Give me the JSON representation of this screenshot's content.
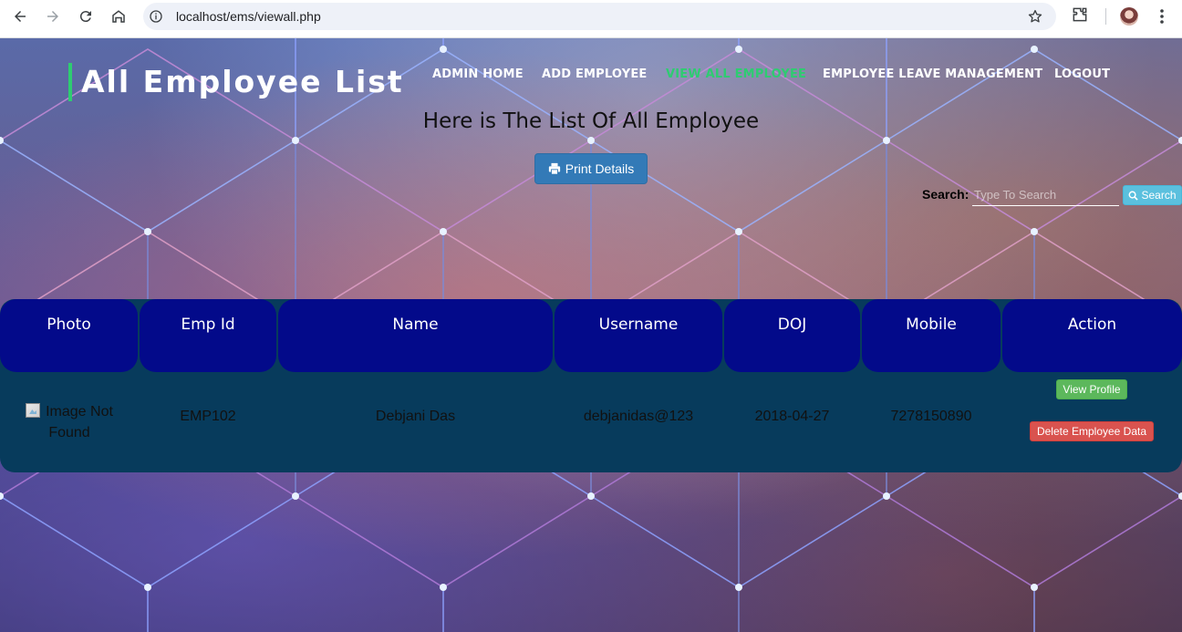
{
  "browser": {
    "url": "localhost/ems/viewall.php"
  },
  "header": {
    "brand": "All Employee List",
    "nav": [
      {
        "label": "ADMIN HOME",
        "active": false
      },
      {
        "label": "ADD EMPLOYEE",
        "active": false
      },
      {
        "label": "VIEW ALL EMPLOYEE",
        "active": true
      },
      {
        "label": "EMPLOYEE LEAVE MANAGEMENT",
        "active": false
      },
      {
        "label": "LOGOUT",
        "active": false
      }
    ]
  },
  "main": {
    "heading": "Here is The List Of All Employee",
    "print_label": "Print Details",
    "search": {
      "label": "Search:",
      "placeholder": "Type To Search",
      "button_label": "Search"
    }
  },
  "table": {
    "columns": [
      "Photo",
      "Emp Id",
      "Name",
      "Username",
      "DOJ",
      "Mobile",
      "Action"
    ],
    "rows": [
      {
        "photo_alt": "Image Not Found",
        "emp_id": "EMP102",
        "name": "Debjani Das",
        "username": "debjanidas@123",
        "doj": "2018-04-27",
        "mobile": "7278150890",
        "view_label": "View Profile",
        "delete_label": "Delete Employee Data"
      }
    ]
  },
  "colors": {
    "accent_green": "#2ecc71",
    "header_cell": "#030a8a",
    "table_bg": "#073b5c",
    "print_button": "#337ab7",
    "search_button": "#5bc0de",
    "view_button": "#5cb85c",
    "delete_button": "#d9534f"
  },
  "icons": {
    "print": "print-icon",
    "search": "search-icon"
  }
}
